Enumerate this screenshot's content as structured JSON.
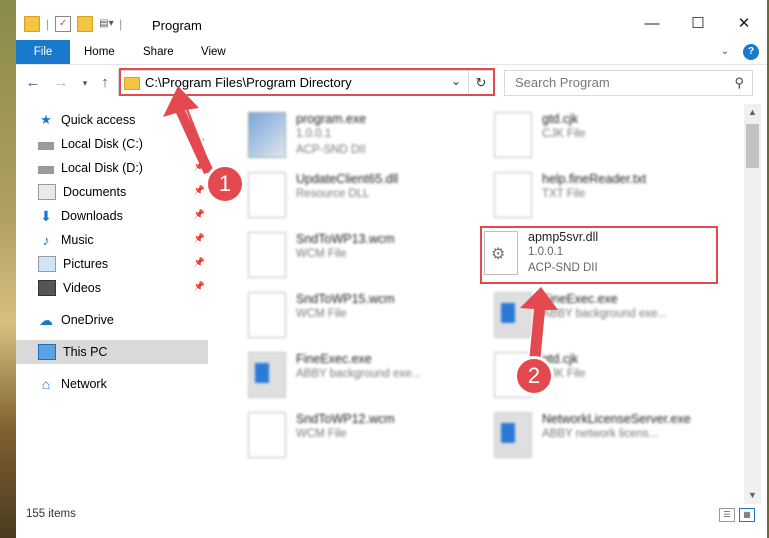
{
  "window": {
    "title": "Program",
    "controls": {
      "minimize": "—",
      "maximize": "☐",
      "close": "✕"
    }
  },
  "ribbon": {
    "tabs": [
      {
        "label": "File",
        "active": true
      },
      {
        "label": "Home"
      },
      {
        "label": "Share"
      },
      {
        "label": "View"
      }
    ]
  },
  "address": {
    "path": "C:\\Program Files\\Program Directory",
    "search_placeholder": "Search Program"
  },
  "nav": [
    {
      "label": "Quick access",
      "icon": "star-icon",
      "pinned": false,
      "selected": false
    },
    {
      "label": "Local Disk (C:)",
      "icon": "drive-icon",
      "pinned": true,
      "selected": false
    },
    {
      "label": "Local Disk (D:)",
      "icon": "drive-icon",
      "pinned": true,
      "selected": false
    },
    {
      "label": "Documents",
      "icon": "documents-icon",
      "pinned": true,
      "selected": false
    },
    {
      "label": "Downloads",
      "icon": "download-icon",
      "pinned": true,
      "selected": false
    },
    {
      "label": "Music",
      "icon": "music-icon",
      "pinned": true,
      "selected": false
    },
    {
      "label": "Pictures",
      "icon": "pictures-icon",
      "pinned": true,
      "selected": false
    },
    {
      "label": "Videos",
      "icon": "videos-icon",
      "pinned": true,
      "selected": false
    },
    {
      "label": "OneDrive",
      "icon": "cloud-icon",
      "pinned": false,
      "selected": false
    },
    {
      "label": "This PC",
      "icon": "computer-icon",
      "pinned": false,
      "selected": true
    },
    {
      "label": "Network",
      "icon": "network-icon",
      "pinned": false,
      "selected": false
    }
  ],
  "files": [
    {
      "name": "program.exe",
      "line1": "1.0.0.1",
      "line2": "ACP-SND DII",
      "icon": "exe-icon"
    },
    {
      "name": "gtd.cjk",
      "line1": "CJK File",
      "line2": "",
      "icon": "document-icon"
    },
    {
      "name": "UpdateClient65.dll",
      "line1": "Resource DLL",
      "line2": "",
      "icon": "dll-icon"
    },
    {
      "name": "help.fineReader.txt",
      "line1": "TXT File",
      "line2": "",
      "icon": "document-icon"
    },
    {
      "name": "SndToWP13.wcm",
      "line1": "WCM File",
      "line2": "",
      "icon": "document-icon"
    },
    {
      "name": "apmp5svr.dll",
      "line1": "1.0.0.1",
      "line2": "ACP-SND DII",
      "icon": "dll-icon",
      "highlighted": true
    },
    {
      "name": "SndToWP15.wcm",
      "line1": "WCM File",
      "line2": "",
      "icon": "document-icon"
    },
    {
      "name": "FineExec.exe",
      "line1": "ABBY background exe...",
      "line2": "",
      "icon": "app-icon"
    },
    {
      "name": "FineExec.exe",
      "line1": "ABBY background exe...",
      "line2": "",
      "icon": "app-icon"
    },
    {
      "name": "gtd.cjk",
      "line1": "CJK File",
      "line2": "",
      "icon": "document-icon"
    },
    {
      "name": "SndToWP12.wcm",
      "line1": "WCM File",
      "line2": "",
      "icon": "document-icon"
    },
    {
      "name": "NetworkLicenseServer.exe",
      "line1": "ABBY network licens...",
      "line2": "",
      "icon": "app-icon"
    }
  ],
  "callouts": [
    "1",
    "2"
  ],
  "status": {
    "item_count": "155 items"
  },
  "colors": {
    "accent": "#1979ca",
    "highlight": "#e34a4f"
  }
}
